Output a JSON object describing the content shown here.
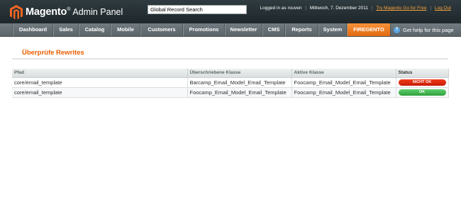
{
  "header": {
    "logo_text": "Magento",
    "logo_reg": "®",
    "logo_subtitle": "Admin Panel",
    "search_value": "Global Record Search",
    "logged_in": "Logged in as rouven",
    "date": "Mittwoch, 7. Dezember 2011",
    "try_link": "Try Magento Go for Free",
    "logout_link": "Log Out",
    "sep": "|",
    "logo_color": "#f26522"
  },
  "nav": {
    "items": [
      {
        "label": "Dashboard"
      },
      {
        "label": "Sales"
      },
      {
        "label": "Catalog"
      },
      {
        "label": "Mobile"
      },
      {
        "label": "Customers"
      },
      {
        "label": "Promotions"
      },
      {
        "label": "Newsletter"
      },
      {
        "label": "CMS"
      },
      {
        "label": "Reports"
      },
      {
        "label": "System"
      },
      {
        "label": "FIREGENTO"
      }
    ],
    "active_index": 10,
    "help_label": "Get help for this page",
    "help_icon_glyph": "?"
  },
  "page": {
    "title": "Überprüfe Rewrites"
  },
  "table": {
    "columns": [
      "Pfad",
      "Überschriebene Klasse",
      "Aktive Klasse",
      "Status"
    ],
    "rows": [
      {
        "path": "core/email_template",
        "overridden": "Barcamp_Email_Model_Email_Template",
        "active": "Foocamp_Email_Model_Email_Template",
        "status": "NICHT OK",
        "status_color": "#e3260c"
      },
      {
        "path": "core/email_template",
        "overridden": "Foocamp_Email_Model_Email_Template",
        "active": "Foocamp_Email_Model_Email_Template",
        "status": "OK",
        "status_color": "#3db74c"
      }
    ]
  }
}
